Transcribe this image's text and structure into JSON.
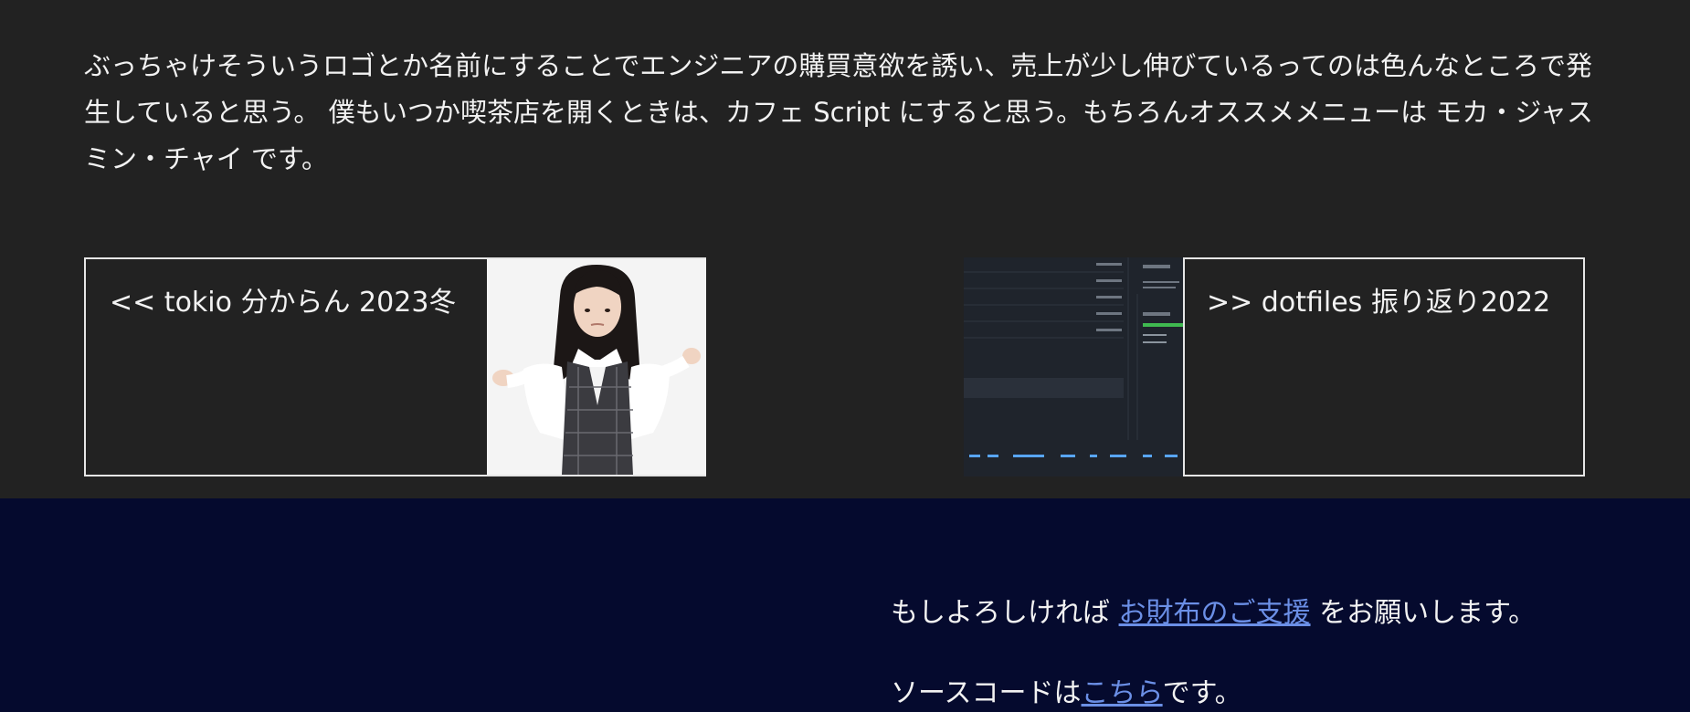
{
  "article": {
    "paragraph": "ぶっちゃけそういうロゴとか名前にすることでエンジニアの購買意欲を誘い、売上が少し伸びているってのは色んなところで発生していると思う。 僕もいつか喫茶店を開くときは、カフェ Script にすると思う。もちろんオススメメニューは モカ・ジャスミン・チャイ です。"
  },
  "pager": {
    "prev_label": "<< tokio 分からん 2023冬",
    "next_label": ">> dotfiles 振り返り2022"
  },
  "footer": {
    "donate_prefix": "もしよろしければ ",
    "donate_link": "お財布のご支援",
    "donate_suffix": " をお願いします。",
    "source_prefix": "ソースコードは",
    "source_link": "こちら",
    "source_suffix": "です。"
  },
  "colors": {
    "background": "#222222",
    "footer_background": "#050a2e",
    "link": "#6b8fe6",
    "text": "#f2f2f2"
  }
}
